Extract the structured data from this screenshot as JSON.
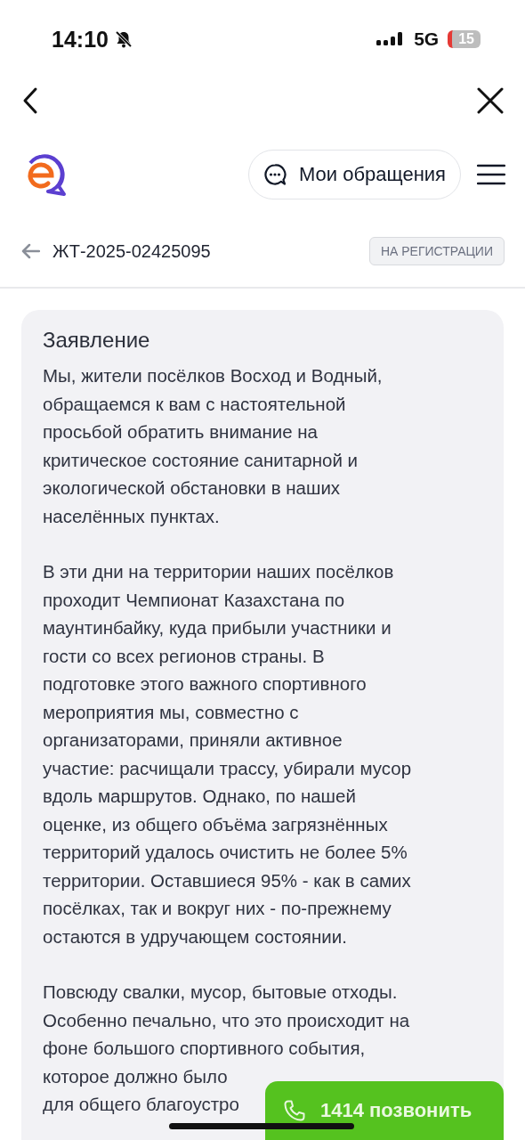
{
  "status_bar": {
    "time": "14:10",
    "network": "5G",
    "battery": "15"
  },
  "header": {
    "my_requests_button": "Мои обращения"
  },
  "request": {
    "number": "ЖТ-2025-02425095",
    "status": "НА РЕГИСТРАЦИИ"
  },
  "statement": {
    "title": "Заявление",
    "paragraphs": [
      [
        "Мы, жители посёлков Восход и Водный,",
        "обращаемся к вам с настоятельной",
        "просьбой обратить внимание на",
        "критическое состояние санитарной и",
        "экологической обстановки в наших",
        "населённых пунктах."
      ],
      [
        "В эти дни на территории наших посёлков",
        "проходит Чемпионат Казахстана по",
        "маунтинбайку, куда прибыли участники и",
        "гости со всех регионов страны. В",
        "подготовке этого важного спортивного",
        "мероприятия мы, совместно с",
        "организаторами, приняли активное",
        "участие: расчищали трассу, убирали мусор",
        "вдоль маршрутов. Однако, по нашей",
        "оценке, из общего объёма загрязнённых",
        "территорий удалось очистить не более 5%",
        "территории. Оставшиеся 95% - как в самих",
        "посёлках, так и вокруг них - по-прежнему",
        "остаются в удручающем состоянии."
      ],
      [
        "Повсюду свалки, мусор, бытовые отходы.",
        "Особенно печально, что это происходит на",
        "фоне большого спортивного события,"
      ],
      {
        "kind": "continued",
        "lines": [
          "которое должно было",
          "для общего благоустро"
        ]
      }
    ]
  },
  "call_button": {
    "label": "1414 позвонить"
  }
}
